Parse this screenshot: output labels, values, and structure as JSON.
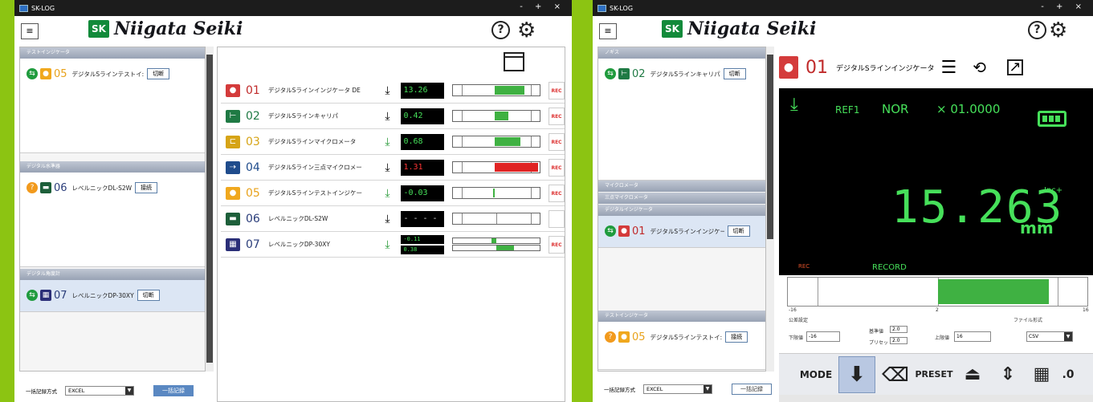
{
  "app": {
    "title": "SK-LOG",
    "window_controls": "- + ×"
  },
  "brand": {
    "logo_mark": "SK",
    "logo_text": "Niigata Seiki"
  },
  "colors": {
    "brand_green": "#8cc412",
    "lcd_green": "#46e05a",
    "alert_red": "#e02424"
  },
  "left_window": {
    "groups": [
      {
        "header": "テストインジケータ",
        "device": {
          "status_icon": "connected-icon",
          "num": "05",
          "name": "デジタルSラインテストイ:",
          "button": "切断"
        }
      },
      {
        "header": "デジタル水準器",
        "device": {
          "status_icon": "unknown-icon",
          "num": "06",
          "name": "レベルニックDL-S2W",
          "button": "接続"
        }
      },
      {
        "header": "デジタル角度計",
        "device": {
          "status_icon": "connected-icon",
          "num": "07",
          "name": "レベルニックDP-30XY",
          "button": "切断"
        }
      }
    ],
    "bulk": {
      "label": "一括記録方式",
      "format": "EXCEL",
      "button": "一括記録"
    },
    "rows": [
      {
        "num": "01",
        "name": "デジタルSラインインジケータ DE",
        "value": "13.26",
        "value_color": "green",
        "fill_start": 0.48,
        "fill_end": 0.82,
        "fill_color": "#3fb142",
        "rec": "REC"
      },
      {
        "num": "02",
        "name": "デジタルSラインキャリパ",
        "value": "0.42",
        "value_color": "green",
        "fill_start": 0.48,
        "fill_end": 0.64,
        "fill_color": "#3fb142",
        "rec": "REC"
      },
      {
        "num": "03",
        "name": "デジタルSラインマイクロメータ",
        "value": "0.68",
        "value_color": "green",
        "fill_start": 0.48,
        "fill_end": 0.78,
        "fill_color": "#3fb142",
        "rec": "REC"
      },
      {
        "num": "04",
        "name": "デジタルSライン三点マイクロメー",
        "value": "1.31",
        "value_color": "red",
        "fill_start": 0.48,
        "fill_end": 0.98,
        "fill_color": "#e02424",
        "rec": "REC"
      },
      {
        "num": "05",
        "name": "デジタルSラインテストインジケー",
        "value": "-0.03",
        "value_color": "green",
        "fill_start": 0.46,
        "fill_end": 0.48,
        "fill_color": "#3fb142",
        "rec": "REC"
      },
      {
        "num": "06",
        "name": "レベルニックDL-S2W",
        "value": "- - - -",
        "value_color": "green",
        "fill_start": 0,
        "fill_end": 0,
        "fill_color": "#3fb142",
        "rec": ""
      },
      {
        "num": "07",
        "name": "レベルニックDP-30XY",
        "value": "-0.11",
        "value2": "0.38",
        "value_color": "green",
        "rec": "REC"
      }
    ]
  },
  "right_window": {
    "groups": [
      {
        "header": "ノギス",
        "device": {
          "num": "02",
          "name": "デジタルSラインキャリパ",
          "button": "切断"
        }
      },
      {
        "header": "マイクロメータ"
      },
      {
        "header": "三点マイクロメータ"
      },
      {
        "header": "デジタルインジケータ",
        "device": {
          "num": "01",
          "name": "デジタルSラインインジケー",
          "button": "切断"
        }
      },
      {
        "header": "テストインジケータ",
        "device": {
          "num": "05",
          "name": "デジタルSラインテストイ:",
          "button": "接続"
        }
      }
    ],
    "bulk": {
      "label": "一括記録方式",
      "format": "EXCEL",
      "button": "一括記録"
    },
    "detail": {
      "num": "01",
      "name": "デジタルSラインインジケータ",
      "lcd": {
        "ref": "REF1",
        "mode": "NOR",
        "mult": "× 01.0000",
        "value": "15.263",
        "unit": "mm",
        "inc": "Inc+",
        "rec": "REC",
        "record": "RECORD"
      },
      "bar_fill_start": 0.5,
      "bar_fill_end": 0.87,
      "scale": {
        "min": "-16",
        "mid": "2",
        "max": "16"
      },
      "tolerance": {
        "title": "公差設定",
        "lower_label": "下限値",
        "lower": "-16",
        "base_label": "基準値",
        "base": "2.0",
        "preset_label": "プリセット",
        "preset": "2.0",
        "upper_label": "上限値",
        "upper": "16"
      },
      "file_format": {
        "label": "ファイル形式",
        "value": "CSV"
      },
      "toolbar": {
        "mode": "MODE",
        "preset": "PRESET",
        "zero": ".0"
      }
    }
  }
}
